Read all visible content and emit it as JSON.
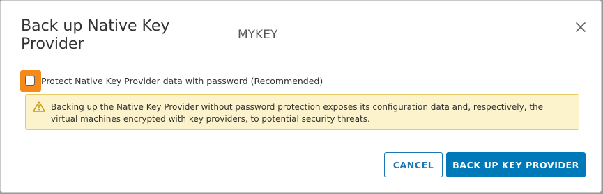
{
  "dialog": {
    "title": "Back up Native Key Provider",
    "subtitle": "MYKEY",
    "close_icon": "close-icon"
  },
  "protect_option": {
    "label": "Protect Native Key Provider data with password (Recommended)",
    "checked": false
  },
  "warning": {
    "icon": "warning-triangle-icon",
    "text": "Backing up the Native Key Provider without password protection exposes its configuration data and, respectively, the virtual machines encrypted with key providers, to potential security threats."
  },
  "footer": {
    "cancel_label": "CANCEL",
    "primary_label": "BACK UP KEY PROVIDER"
  },
  "colors": {
    "primary": "#0079b8",
    "focus": "#f48a1b",
    "warning_bg": "#fcf3cc",
    "warning_border": "#e8cd63"
  }
}
